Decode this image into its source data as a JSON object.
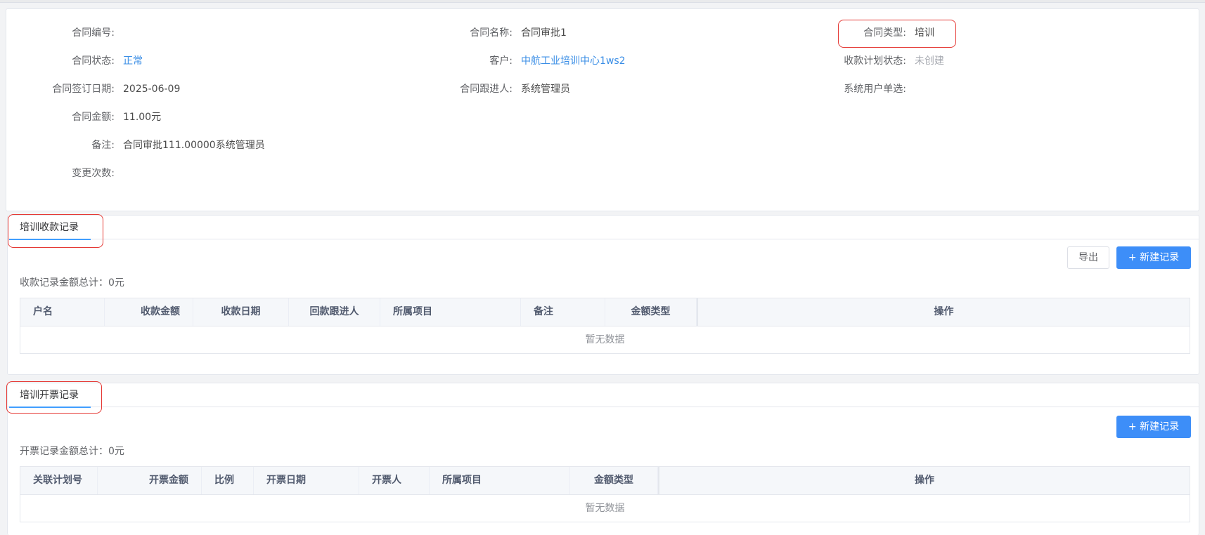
{
  "info": {
    "contract_no": {
      "label": "合同编号:",
      "value": ""
    },
    "contract_name": {
      "label": "合同名称:",
      "value": "合同审批1"
    },
    "contract_type": {
      "label": "合同类型:",
      "value": "培训"
    },
    "contract_status": {
      "label": "合同状态:",
      "value": "正常"
    },
    "customer": {
      "label": "客户:",
      "value": "中航工业培训中心1ws2"
    },
    "payment_plan_status": {
      "label": "收款计划状态:",
      "value": "未创建"
    },
    "sign_date": {
      "label": "合同签订日期:",
      "value": "2025-06-09"
    },
    "follower": {
      "label": "合同跟进人:",
      "value": "系统管理员"
    },
    "system_user": {
      "label": "系统用户单选:",
      "value": ""
    },
    "amount": {
      "label": "合同金额:",
      "value": "11.00元"
    },
    "remark": {
      "label": "备注:",
      "value": "合同审批111.00000系统管理员"
    },
    "change_count": {
      "label": "变更次数:",
      "value": ""
    }
  },
  "payment_section": {
    "tab_label": "培训收款记录",
    "export_label": "导出",
    "new_label": "+ 新建记录",
    "total_text": "收款记录金额总计：0元",
    "columns": [
      "户名",
      "收款金额",
      "收款日期",
      "回款跟进人",
      "所属项目",
      "备注",
      "金额类型",
      "操作"
    ],
    "empty_text": "暂无数据"
  },
  "invoice_section": {
    "tab_label": "培训开票记录",
    "new_label": "+ 新建记录",
    "total_text": "开票记录金额总计：0元",
    "columns": [
      "关联计划号",
      "开票金额",
      "比例",
      "开票日期",
      "开票人",
      "所属项目",
      "金额类型",
      "操作"
    ],
    "empty_text": "暂无数据"
  },
  "colors": {
    "primary": "#3d8ef8",
    "link": "#3a8ee6",
    "highlight": "#e53935",
    "muted": "#a8abb2"
  }
}
